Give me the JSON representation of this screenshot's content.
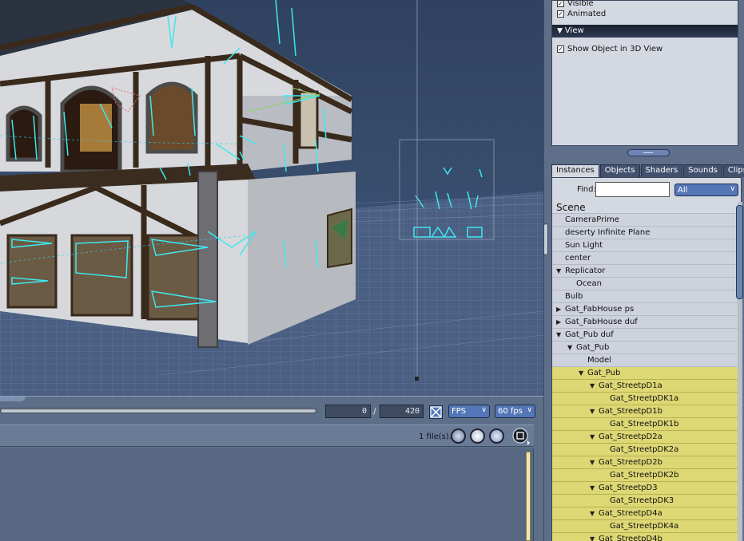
{
  "properties": {
    "visible_label": "Visible",
    "animated_label": "Animated",
    "view_section_title": "View",
    "show_object_label": "Show Object in 3D View"
  },
  "tabs": [
    "Instances",
    "Objects",
    "Shaders",
    "Sounds",
    "Clips"
  ],
  "find": {
    "label": "Find:",
    "value": "",
    "filter_selected": "All"
  },
  "scene_title": "Scene",
  "tree": [
    {
      "label": "CameraPrime",
      "depth": 0,
      "arrow": "none",
      "highlight": false
    },
    {
      "label": "deserty Infinite Plane",
      "depth": 0,
      "arrow": "none",
      "highlight": false
    },
    {
      "label": "Sun Light",
      "depth": 0,
      "arrow": "none",
      "highlight": false
    },
    {
      "label": "center",
      "depth": 0,
      "arrow": "none",
      "highlight": false
    },
    {
      "label": "Replicator",
      "depth": 0,
      "arrow": "down",
      "highlight": false
    },
    {
      "label": "Ocean",
      "depth": 1,
      "arrow": "none",
      "highlight": false
    },
    {
      "label": "Bulb",
      "depth": 0,
      "arrow": "none",
      "highlight": false
    },
    {
      "label": "Gat_FabHouse ps",
      "depth": 0,
      "arrow": "right",
      "highlight": false
    },
    {
      "label": "Gat_FabHouse duf",
      "depth": 0,
      "arrow": "right",
      "highlight": false
    },
    {
      "label": "Gat_Pub duf",
      "depth": 0,
      "arrow": "down",
      "highlight": false
    },
    {
      "label": "Gat_Pub",
      "depth": 1,
      "arrow": "down",
      "highlight": false
    },
    {
      "label": "Model",
      "depth": 2,
      "arrow": "none",
      "highlight": false
    },
    {
      "label": "Gat_Pub",
      "depth": 2,
      "arrow": "down",
      "highlight": true
    },
    {
      "label": "Gat_StreetpD1a",
      "depth": 3,
      "arrow": "down",
      "highlight": true
    },
    {
      "label": "Gat_StreetpDK1a",
      "depth": 4,
      "arrow": "none",
      "highlight": true
    },
    {
      "label": "Gat_StreetpD1b",
      "depth": 3,
      "arrow": "down",
      "highlight": true
    },
    {
      "label": "Gat_StreetpDK1b",
      "depth": 4,
      "arrow": "none",
      "highlight": true
    },
    {
      "label": "Gat_StreetpD2a",
      "depth": 3,
      "arrow": "down",
      "highlight": true
    },
    {
      "label": "Gat_StreetpDK2a",
      "depth": 4,
      "arrow": "none",
      "highlight": true
    },
    {
      "label": "Gat_StreetpD2b",
      "depth": 3,
      "arrow": "down",
      "highlight": true
    },
    {
      "label": "Gat_StreetpDK2b",
      "depth": 4,
      "arrow": "none",
      "highlight": true
    },
    {
      "label": "Gat_StreetpD3",
      "depth": 3,
      "arrow": "down",
      "highlight": true
    },
    {
      "label": "Gat_StreetpDK3",
      "depth": 4,
      "arrow": "none",
      "highlight": true
    },
    {
      "label": "Gat_StreetpD4a",
      "depth": 3,
      "arrow": "down",
      "highlight": true
    },
    {
      "label": "Gat_StreetpDK4a",
      "depth": 4,
      "arrow": "none",
      "highlight": true
    },
    {
      "label": "Gat_StreetpD4b",
      "depth": 3,
      "arrow": "down",
      "highlight": true
    }
  ],
  "timeline": {
    "current_frame": "0",
    "separator": "/",
    "total_frames": "420",
    "mode": "FPS",
    "rate": "60 fps"
  },
  "library": {
    "files_count_label": "1 file(s)."
  },
  "colors": {
    "viewport_sky": "#2f4260",
    "highlight_row": "#ddd774",
    "wireframe": "#3ee8ee",
    "accent_blue": "#5376b6"
  }
}
